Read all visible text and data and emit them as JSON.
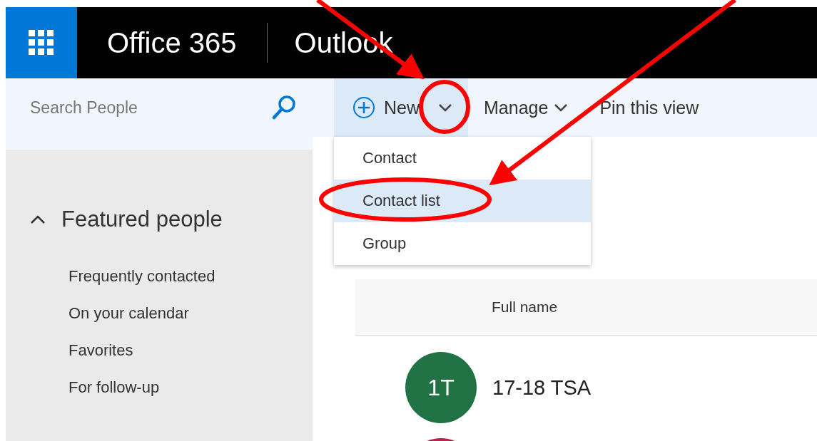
{
  "header": {
    "suite": "Office 365",
    "app": "Outlook"
  },
  "search": {
    "placeholder": "Search People"
  },
  "toolbar": {
    "new_label": "New",
    "new_menu_open": true,
    "items": [
      "Manage",
      "Pin this view"
    ]
  },
  "new_menu": [
    {
      "label": "Contact",
      "selected": false
    },
    {
      "label": "Contact list",
      "selected": true
    },
    {
      "label": "Group",
      "selected": false
    }
  ],
  "sidebar": {
    "section": {
      "title": "Featured people",
      "expanded": true,
      "items": [
        "Frequently contacted",
        "On your calendar",
        "Favorites",
        "For follow-up"
      ]
    }
  },
  "table": {
    "columns": [
      "Full name"
    ],
    "rows": [
      {
        "initials": "1T",
        "name": "17-18 TSA",
        "color": "#217346"
      },
      {
        "color": "#b8224f"
      }
    ]
  }
}
